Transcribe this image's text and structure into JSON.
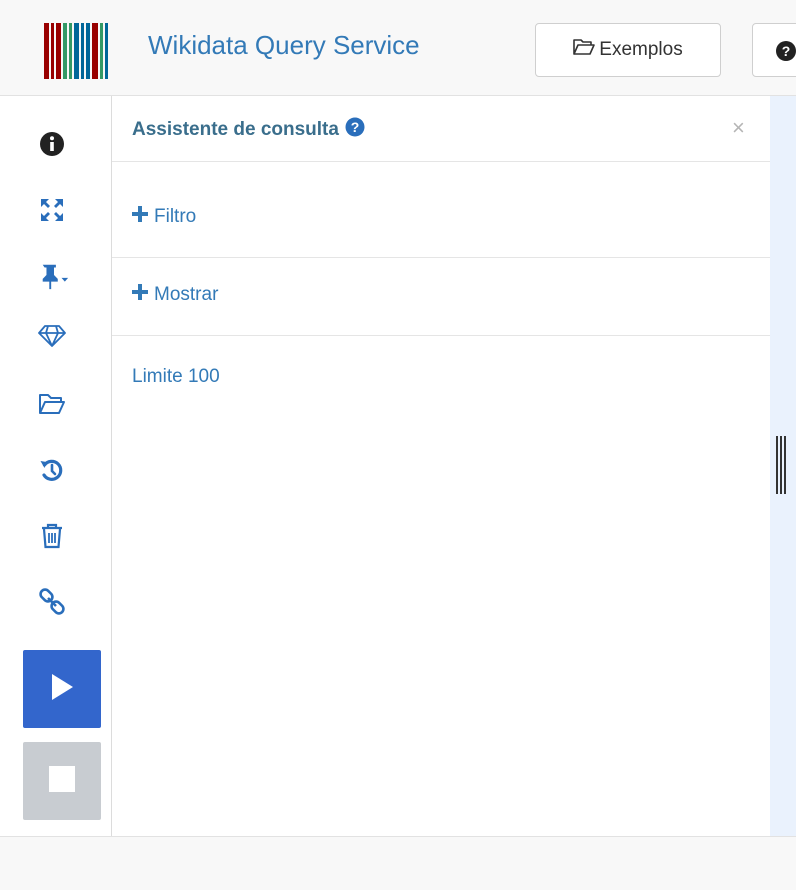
{
  "header": {
    "brand": "Wikidata Query Service",
    "examples_label": "Exemplos",
    "logo_colors": [
      "#990000",
      "#990000",
      "#990000",
      "#339966",
      "#339966",
      "#006699",
      "#006699",
      "#006699",
      "#990000",
      "#339966",
      "#006699"
    ]
  },
  "sidebar": {
    "icons": [
      "info-icon",
      "fullscreen-icon",
      "pin-icon",
      "gem-icon",
      "folder-open-icon",
      "history-icon",
      "trash-icon",
      "link-icon"
    ],
    "run_color": "#3366cc",
    "stop_color": "#c8ccd1"
  },
  "panel": {
    "title": "Assistente de consulta",
    "filter_label": "Filtro",
    "show_label": "Mostrar",
    "limit_label": "Limite 100"
  }
}
